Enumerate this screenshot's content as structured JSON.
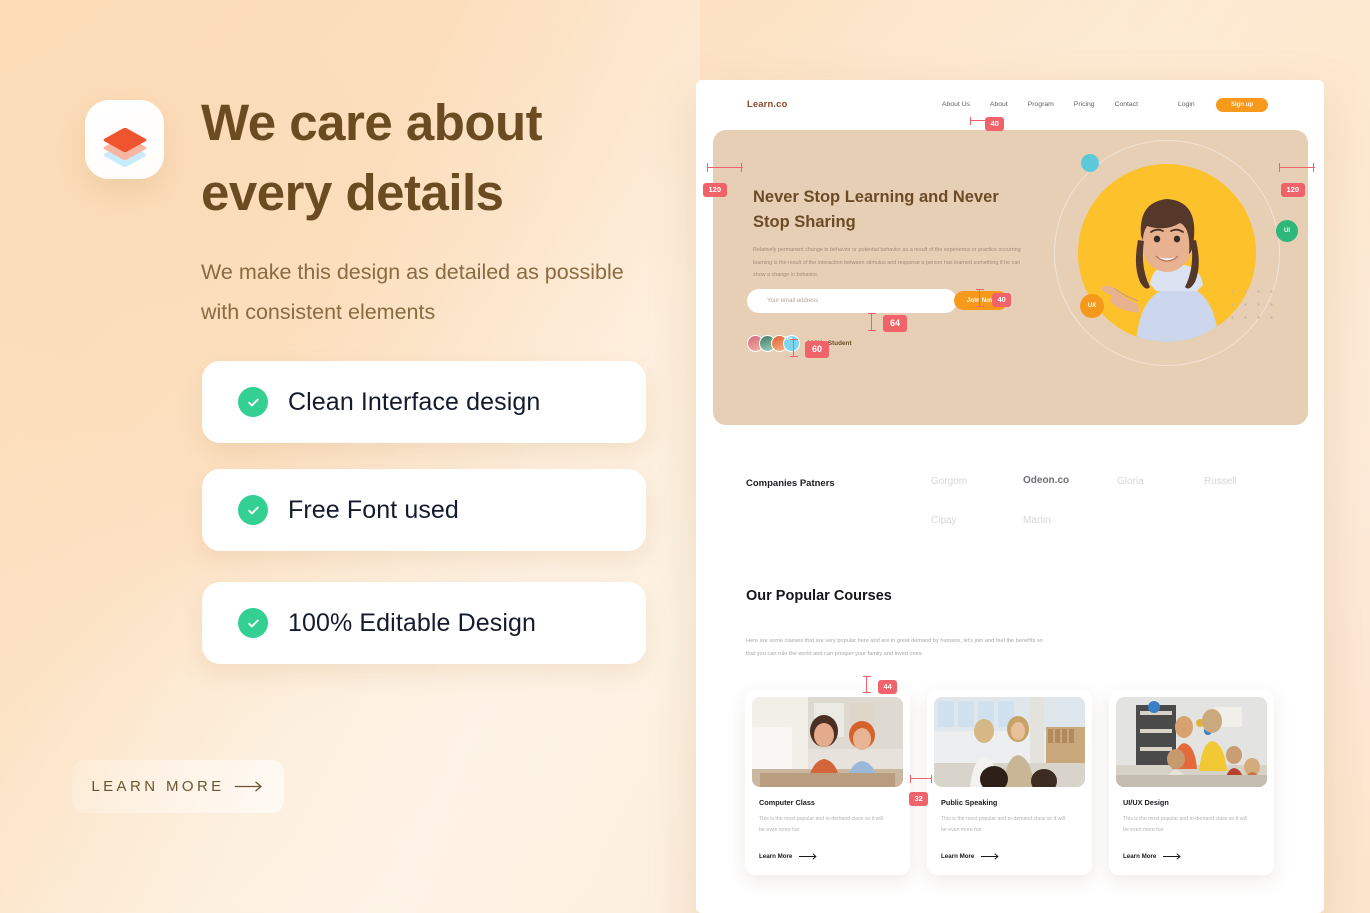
{
  "left_panel": {
    "logo_icon": "layers-stack-icon",
    "headline": "We care about every details",
    "subhead": "We make this design as detailed as possible with consistent elements",
    "features": [
      {
        "label": "Clean Interface design",
        "icon": "check-circle-icon"
      },
      {
        "label": "Free Font used",
        "icon": "check-circle-icon"
      },
      {
        "label": "100% Editable Design",
        "icon": "check-circle-icon"
      }
    ],
    "cta": {
      "label": "LEARN MORE",
      "icon": "arrow-right-icon"
    },
    "colors": {
      "headline": "#6b4c22",
      "subhead": "#8a6b42",
      "check": "#34cf93",
      "logo_top": "#ef542f",
      "logo_mid": "#f7b6a2",
      "logo_bottom": "#c8ecfb"
    }
  },
  "mockup": {
    "nav": {
      "brand": "Learn.co",
      "links": [
        "About Us",
        "About",
        "Program",
        "Pricing",
        "Contact"
      ],
      "login": "Login",
      "signup": "Sign up",
      "signup_color": "#f79a1c"
    },
    "hero": {
      "title": "Never Stop Learning and Never Stop Sharing",
      "body": "Relatively permanent change in behavior or potential behavior as a result of the experience or practice occurring learning is the result of the interaction between stimulus and response a person has learned something if he can show a change in behavior.",
      "email_placeholder": "Your email address",
      "join_label": "Join Now",
      "students_count": "120K+ Student",
      "avatar_more": "10+",
      "badges": [
        {
          "label": "",
          "name": "badge-teal",
          "color": "#5cc8d8"
        },
        {
          "label": "UI",
          "name": "badge-ui",
          "color": "#2db87a"
        },
        {
          "label": "UX",
          "name": "badge-ux",
          "color": "#f5991c"
        }
      ],
      "card_bg": "#e7cfb6",
      "photo_bg": "#fdc22b"
    },
    "partners": {
      "title": "Companies Patners",
      "items": [
        {
          "name": "Gorgom",
          "highlighted": false
        },
        {
          "name": "Odeon.co",
          "highlighted": true
        },
        {
          "name": "Gloria",
          "highlighted": false
        },
        {
          "name": "Russell",
          "highlighted": false
        },
        {
          "name": "Cipay",
          "highlighted": false
        },
        {
          "name": "Martin",
          "highlighted": false
        }
      ]
    },
    "courses": {
      "title": "Our Popular Courses",
      "body": "Here are some classes that are very popular here and are in great demand by humans, let's join and feel the benefits so that you can rule the world and can prosper your family and loved ones",
      "cards": [
        {
          "name": "Computer Class",
          "desc": "This is the most popular and in-demand class so it will be even more fun",
          "cta": "Learn More"
        },
        {
          "name": "Public Speaking",
          "desc": "This is the most popular and in-demand class so it will be even more fun",
          "cta": "Learn More"
        },
        {
          "name": "UI/UX Design",
          "desc": "This is the most popular and in-demand class so it will be even more fun",
          "cta": "Learn More"
        }
      ]
    }
  },
  "measurements": {
    "nav_gap": "40",
    "hero_left": "120",
    "hero_right": "120",
    "hero_form_top": "40",
    "form_height": "64",
    "students_top": "60",
    "card_top": "44",
    "card_gap": "32",
    "chip_color": "#f0636b"
  }
}
